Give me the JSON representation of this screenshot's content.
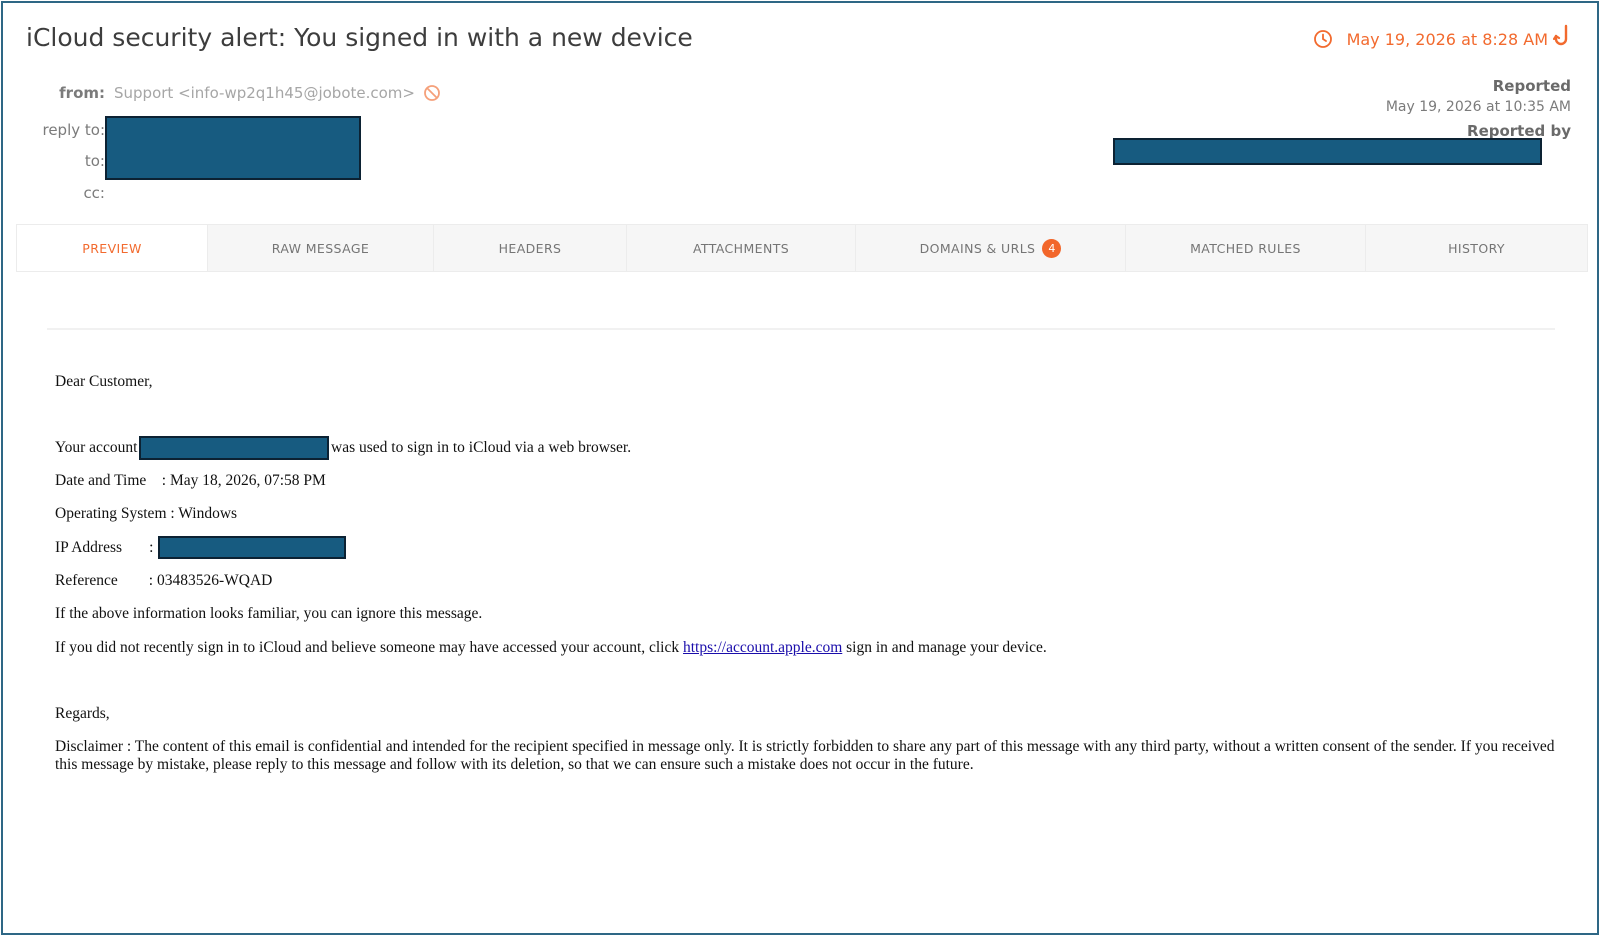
{
  "header": {
    "subject": "iCloud security alert: You signed in with a new device",
    "received": "May 19, 2026 at 8:28 AM",
    "from_label": "from:",
    "from_value": "Support  <info-wp2q1h45@jobote.com>",
    "reply_to_label": "reply to:",
    "to_label": "to:",
    "cc_label": "cc:",
    "reported_label": "Reported",
    "reported_date": "May 19, 2026 at 10:35 AM",
    "reported_by_label": "Reported by"
  },
  "tabs": [
    {
      "label": "PREVIEW",
      "active": true
    },
    {
      "label": "RAW MESSAGE"
    },
    {
      "label": "HEADERS"
    },
    {
      "label": "ATTACHMENTS"
    },
    {
      "label": "DOMAINS & URLS",
      "badge": "4"
    },
    {
      "label": "MATCHED RULES"
    },
    {
      "label": "HISTORY"
    }
  ],
  "email": {
    "greeting": "Dear Customer,",
    "account_prefix": "Your account",
    "account_suffix": "was used to sign in to iCloud via a web browser.",
    "datetime_line": "Date and Time    : May 18, 2026, 07:58 PM",
    "os_line": "Operating System : Windows",
    "ip_label": "IP Address       :",
    "reference_line": "Reference        : 03483526-WQAD",
    "familiar_line": "If the above information looks familiar, you can ignore this message.",
    "link_prefix": "If you did not recently sign in to iCloud and believe someone may have accessed your account, click ",
    "link_text": "https://account.apple.com",
    "link_suffix": " sign in and manage your device.",
    "regards": "Regards,",
    "disclaimer": "Disclaimer : The content of this email is confidential and intended for the recipient specified in message only. It is strictly forbidden to share any part of this message with any third party, without a written consent of the sender. If you received this message by mistake, please reply to this message and follow with its deletion, so that we can ensure such a mistake does not occur in the future."
  },
  "colors": {
    "accent": "#f26a2e",
    "redaction": "#175b80",
    "frame": "#2e6785"
  },
  "icons": {
    "timestamp": "clock-icon",
    "report": "hook-icon",
    "block_sender": "block-icon"
  }
}
